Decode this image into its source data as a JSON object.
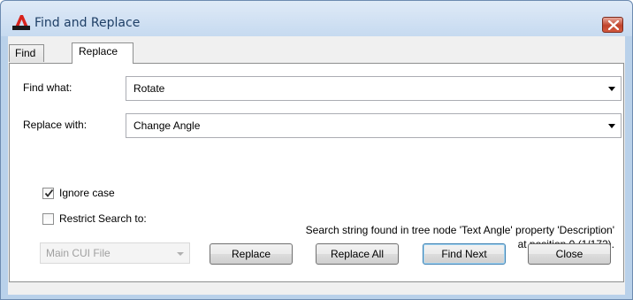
{
  "window": {
    "title": "Find and Replace"
  },
  "tabs": [
    {
      "label": "Find"
    },
    {
      "label": "Replace"
    }
  ],
  "find_what": {
    "label": "Find what:",
    "value": "Rotate"
  },
  "replace_with": {
    "label": "Replace with:",
    "value": "Change Angle"
  },
  "options": {
    "ignore_case": {
      "label": "Ignore case",
      "checked": true
    },
    "restrict_search": {
      "label": "Restrict Search to:",
      "checked": false
    },
    "restrict_target": {
      "value": "Main CUI File"
    }
  },
  "status": {
    "line1": "Search string found in tree node 'Text Angle' property 'Description'",
    "line2": "at position 0 (1/172)."
  },
  "buttons": {
    "replace": "Replace",
    "replace_all": "Replace All",
    "find_next": "Find Next",
    "close": "Close"
  },
  "icons": {
    "app": "autocad-a-icon",
    "close": "close-x-icon",
    "dropdown": "chevron-down-icon",
    "check": "checkmark-icon"
  },
  "colors": {
    "titlebar": "#c6daf0",
    "title_text": "#1e3f66",
    "close_button": "#c0432b",
    "panel": "#ffffff",
    "dialog_bg": "#f0f0f0"
  }
}
